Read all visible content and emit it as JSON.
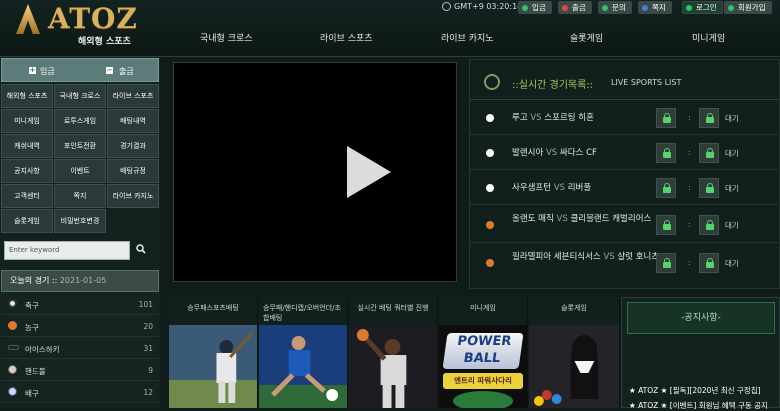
{
  "brand": {
    "name": "ATOZ",
    "subtitle": "해외형 스포츠"
  },
  "clock": {
    "text": "GMT+9 03:20:14"
  },
  "topbar": {
    "deposit": "입금",
    "withdraw": "출금",
    "inquiry": "문의",
    "note": "쪽지",
    "login": "로그인",
    "signup": "회원가입"
  },
  "nav": [
    "국내형 크로스",
    "라이브 스포츠",
    "라이브 카지노",
    "슬롯게임",
    "미니게임"
  ],
  "left": {
    "deposit": "입금",
    "withdraw": "출금",
    "menu": [
      "해외형 스포츠",
      "국내형 크로스",
      "라이브 스포츠",
      "미니게임",
      "로투스게임",
      "배팅내역",
      "캐쉬내역",
      "포인트전환",
      "경기결과",
      "공지사항",
      "이벤트",
      "배팅규정",
      "고객센터",
      "쪽지",
      "라이브 카지노",
      "슬롯게임",
      "비밀번호변경"
    ],
    "search_placeholder": "Enter keyword",
    "today_label": "오늘의 경기 ::",
    "today_date": "2021-01-05",
    "sports": [
      {
        "name": "축구",
        "count": "101",
        "color": "#e9e9e9"
      },
      {
        "name": "농구",
        "count": "20",
        "color": "#e07a2b"
      },
      {
        "name": "아이스하키",
        "count": "31",
        "color": "#222222"
      },
      {
        "name": "핸드볼",
        "count": "9",
        "color": "#d8d0c0"
      },
      {
        "name": "배구",
        "count": "12",
        "color": "#cfd7e8"
      }
    ]
  },
  "live": {
    "title": "::실시간 경기목록::",
    "subtitle": "LIVE SPORTS LIST",
    "vs": "VS",
    "colon": ":",
    "matches": [
      {
        "home": "루고",
        "away": "스포르팅 히혼",
        "status": "대기",
        "ball": "#ffffff"
      },
      {
        "home": "발렌시아",
        "away": "싸다스 CF",
        "status": "대기",
        "ball": "#ffffff"
      },
      {
        "home": "사우샘프턴",
        "away": "리버풀",
        "status": "대기",
        "ball": "#ffffff"
      },
      {
        "home": "올랜도 매직",
        "away": "클리블랜드 캐벌리어스",
        "status": "대기",
        "ball": "#e07a2b"
      },
      {
        "home": "필라델피아 세븐티식서스",
        "away": "샬럿 호니츠",
        "status": "대기",
        "ball": "#e07a2b"
      }
    ]
  },
  "tiles": [
    "승무패스포츠배팅",
    "승무패/핸디캡/오버언더/조합배팅",
    "실시간 배팅 쿼터별 진행",
    "미니게임",
    "슬롯게임"
  ],
  "promo": {
    "power": "POWER",
    "ball": "BALL",
    "tagline": "엔트리 파워사다리"
  },
  "notice": {
    "title": "-공지사항-",
    "item1": "★ ATOZ ★ [필독][2020년 최신 구정칩]",
    "item2": "★ ATOZ ★ [이벤트] 회원님 혜택 구동 공지"
  }
}
